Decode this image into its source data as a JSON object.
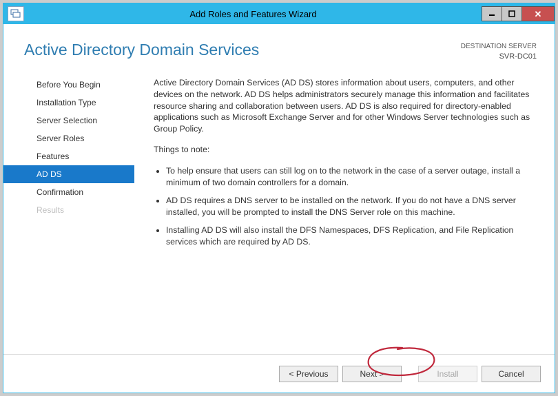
{
  "titlebar": {
    "title": "Add Roles and Features Wizard"
  },
  "header": {
    "page_title": "Active Directory Domain Services",
    "destination_label": "DESTINATION SERVER",
    "destination_server": "SVR-DC01"
  },
  "nav": {
    "items": [
      {
        "label": "Before You Begin",
        "state": "normal"
      },
      {
        "label": "Installation Type",
        "state": "normal"
      },
      {
        "label": "Server Selection",
        "state": "normal"
      },
      {
        "label": "Server Roles",
        "state": "normal"
      },
      {
        "label": "Features",
        "state": "normal"
      },
      {
        "label": "AD DS",
        "state": "active"
      },
      {
        "label": "Confirmation",
        "state": "normal"
      },
      {
        "label": "Results",
        "state": "disabled"
      }
    ]
  },
  "content": {
    "intro": "Active Directory Domain Services (AD DS) stores information about users, computers, and other devices on the network.  AD DS helps administrators securely manage this information and facilitates resource sharing and collaboration between users.  AD DS is also required for directory-enabled applications such as Microsoft Exchange Server and for other Windows Server technologies such as Group Policy.",
    "note_header": "Things to note:",
    "bullets": [
      "To help ensure that users can still log on to the network in the case of a server outage, install a minimum of two domain controllers for a domain.",
      "AD DS requires a DNS server to be installed on the network.  If you do not have a DNS server installed, you will be prompted to install the DNS Server role on this machine.",
      "Installing AD DS will also install the DFS Namespaces, DFS Replication, and File Replication services which are required by AD DS."
    ]
  },
  "footer": {
    "previous": "< Previous",
    "next": "Next >",
    "install": "Install",
    "cancel": "Cancel"
  }
}
